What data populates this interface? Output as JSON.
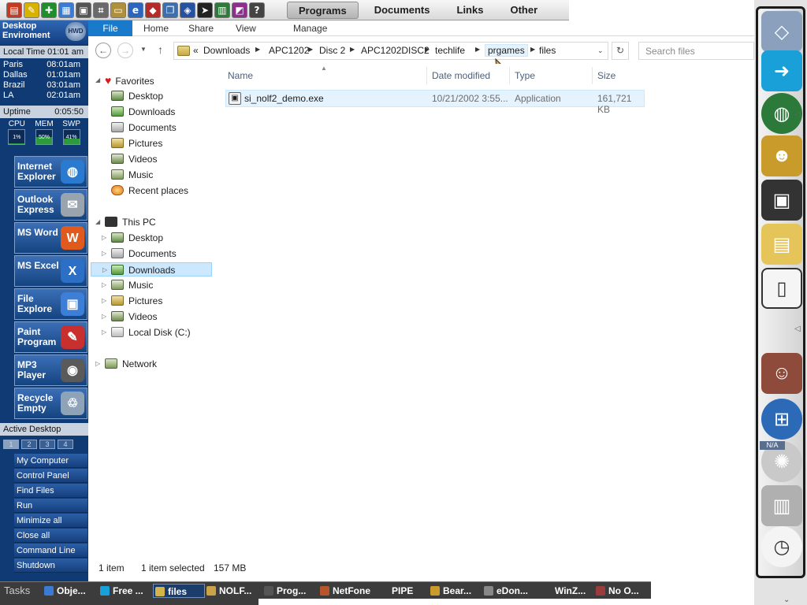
{
  "quicklaunch": {
    "icons": [
      {
        "name": "toolbox-icon",
        "color": "#c23b22",
        "glyph": "▤"
      },
      {
        "name": "pencil-icon",
        "color": "#d8b200",
        "glyph": "✎"
      },
      {
        "name": "plus-icon",
        "color": "#1e8f2a",
        "glyph": "✚"
      },
      {
        "name": "calculator-icon",
        "color": "#3a7bd5",
        "glyph": "▦"
      },
      {
        "name": "image-edit-icon",
        "color": "#555555",
        "glyph": "▣"
      },
      {
        "name": "network-icon",
        "color": "#6a6a6a",
        "glyph": "⌗"
      },
      {
        "name": "drive-icon",
        "color": "#b08f3b",
        "glyph": "▭"
      },
      {
        "name": "ie-icon",
        "color": "#2b65c0",
        "glyph": "e"
      },
      {
        "name": "bookmark-icon",
        "color": "#b32b2b",
        "glyph": "◆"
      },
      {
        "name": "copy-icon",
        "color": "#3c6fb0",
        "glyph": "❐"
      },
      {
        "name": "shield-icon",
        "color": "#2650a0",
        "glyph": "◈"
      },
      {
        "name": "cursor-icon",
        "color": "#222222",
        "glyph": "➤"
      },
      {
        "name": "window-icon",
        "color": "#2f7a3a",
        "glyph": "▥"
      },
      {
        "name": "book-icon",
        "color": "#8e2f8e",
        "glyph": "◩"
      },
      {
        "name": "help-icon",
        "color": "#444444",
        "glyph": "?"
      }
    ],
    "menu": [
      "Programs",
      "Documents",
      "Links",
      "Other"
    ]
  },
  "leftpanel": {
    "title": "Desktop Enviroment",
    "hwd": "HWD",
    "localtime_label": "Local Time",
    "localtime_value": "01:01 am",
    "cities": [
      {
        "city": "Paris",
        "time": "08:01am"
      },
      {
        "city": "Dallas",
        "time": "01:01am"
      },
      {
        "city": "Brazil",
        "time": "03:01am"
      },
      {
        "city": "LA",
        "time": "02:01am"
      }
    ],
    "uptime_label": "Uptime",
    "uptime_value": "0:05:50",
    "meters": [
      {
        "label": "CPU",
        "value": "1%",
        "level": 0.01
      },
      {
        "label": "MEM",
        "value": "50%",
        "level": 0.5
      },
      {
        "label": "SWP",
        "value": "41%",
        "level": 0.41
      }
    ],
    "apps": [
      {
        "label": "Internet Explorer",
        "icon": "globe-icon",
        "glyph": "◍",
        "color": "#2a7bd0"
      },
      {
        "label": "Outlook Express",
        "icon": "mail-icon",
        "glyph": "✉",
        "color": "#9aa4ae"
      },
      {
        "label": "MS Word",
        "icon": "word-icon",
        "glyph": "W",
        "color": "#e05a1e"
      },
      {
        "label": "MS Excel",
        "icon": "excel-icon",
        "glyph": "X",
        "color": "#2b6fc6"
      },
      {
        "label": "File Explore",
        "icon": "folder-icon",
        "glyph": "▣",
        "color": "#3d7fd6"
      },
      {
        "label": "Paint Program",
        "icon": "paint-icon",
        "glyph": "✎",
        "color": "#c83030"
      },
      {
        "label": "MP3 Player",
        "icon": "speaker-icon",
        "glyph": "◉",
        "color": "#5a5a5a"
      },
      {
        "label": "Recycle Empty",
        "icon": "recycle-bin-icon",
        "glyph": "♲",
        "color": "#8fa3b8"
      }
    ],
    "active_desktop_label": "Active Desktop",
    "desktops": [
      "1",
      "2",
      "3",
      "4"
    ],
    "menu": [
      "My Computer",
      "Control Panel",
      "Find Files",
      "Run",
      "Minimize all",
      "Close all",
      "Command Line",
      "Shutdown"
    ]
  },
  "explorer": {
    "ribbon": [
      "File",
      "Home",
      "Share",
      "View",
      "Manage"
    ],
    "address": {
      "prefix": "«",
      "crumbs": [
        "Downloads",
        "APC1202",
        "Disc 2",
        "APC1202DISC2",
        "techlife",
        "prgames",
        "files"
      ]
    },
    "search_placeholder": "Search files",
    "favorites_label": "Favorites",
    "favorites": [
      "Desktop",
      "Downloads",
      "Documents",
      "Pictures",
      "Videos",
      "Music",
      "Recent places"
    ],
    "thispc_label": "This PC",
    "thispc": [
      "Desktop",
      "Documents",
      "Downloads",
      "Music",
      "Pictures",
      "Videos",
      "Local Disk (C:)"
    ],
    "network_label": "Network",
    "columns": [
      "Name",
      "Date modified",
      "Type",
      "Size"
    ],
    "files": [
      {
        "name": "si_nolf2_demo.exe",
        "date": "10/21/2002 3:55...",
        "type": "Application",
        "size": "161,721 KB"
      }
    ],
    "status": {
      "count": "1 item",
      "selected": "1 item selected",
      "size": "157 MB"
    }
  },
  "taskbar": {
    "label": "Tasks",
    "items": [
      {
        "label": "Obje...",
        "color": "#3a7bd5"
      },
      {
        "label": "Free ...",
        "color": "#1aa0d8"
      },
      {
        "label": "files",
        "color": "#d3b44a"
      },
      {
        "label": "NOLF...",
        "color": "#c9a24a"
      },
      {
        "label": "Prog...",
        "color": "#555555"
      },
      {
        "label": "NetFone",
        "color": "#b8542a"
      },
      {
        "label": "PIPE",
        "color": ""
      },
      {
        "label": "Bear...",
        "color": "#c89b2a"
      },
      {
        "label": "eDon...",
        "color": "#888888"
      },
      {
        "label": "WinZ...",
        "color": ""
      },
      {
        "label": "No O...",
        "color": "#9b3b3b"
      }
    ]
  },
  "dock": {
    "icons": [
      {
        "name": "map-icon",
        "color": "#8aa0bd",
        "glyph": "◇"
      },
      {
        "name": "export-arrow-icon",
        "color": "#1aa0d8",
        "glyph": "➜"
      },
      {
        "name": "globe-icon",
        "color": "#2b7a3a",
        "glyph": "◍"
      },
      {
        "name": "bear-icon",
        "color": "#c89b2a",
        "glyph": "☻"
      },
      {
        "name": "computer-cd-icon",
        "color": "#333333",
        "glyph": "▣"
      },
      {
        "name": "folder-icon",
        "color": "#e5c55a",
        "glyph": "▤"
      },
      {
        "name": "document-icon",
        "color": "#f5f5f5",
        "glyph": "▯"
      },
      {
        "name": "woman-avatar-icon",
        "color": "#8e4a3a",
        "glyph": "☺"
      },
      {
        "name": "windows-orb-icon",
        "color": "#2c6ab8",
        "glyph": "⊞"
      },
      {
        "name": "na-icon",
        "color": "#c9c9c9",
        "glyph": "✺"
      },
      {
        "name": "trash-icon",
        "color": "#b0b0b0",
        "glyph": "▥"
      },
      {
        "name": "clock-icon",
        "color": "#f4f4f4",
        "glyph": "◷"
      }
    ],
    "na_label": "N/A"
  }
}
